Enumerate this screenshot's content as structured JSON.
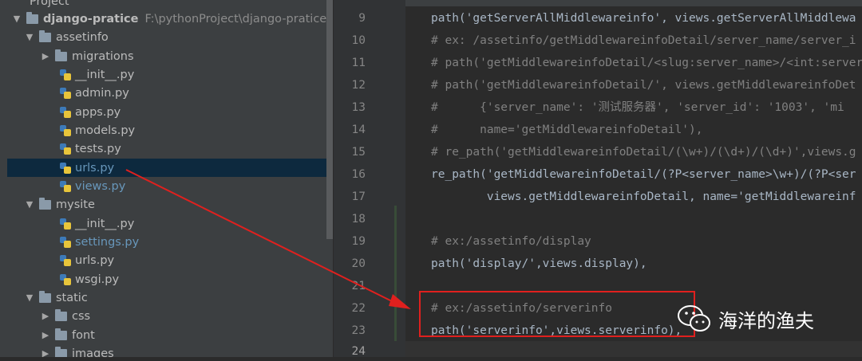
{
  "project_tree": {
    "header": "Project",
    "rows": [
      {
        "label": "django-pratice",
        "path": "F:\\pythonProject\\django-pratice",
        "type": "root"
      },
      {
        "label": "assetinfo",
        "type": "folder"
      },
      {
        "label": "migrations",
        "type": "folder"
      },
      {
        "label": "__init__.py",
        "type": "file"
      },
      {
        "label": "admin.py",
        "type": "file"
      },
      {
        "label": "apps.py",
        "type": "file"
      },
      {
        "label": "models.py",
        "type": "file"
      },
      {
        "label": "tests.py",
        "type": "file"
      },
      {
        "label": "urls.py",
        "type": "file",
        "selected": true
      },
      {
        "label": "views.py",
        "type": "file"
      },
      {
        "label": "mysite",
        "type": "folder"
      },
      {
        "label": "__init__.py",
        "type": "file"
      },
      {
        "label": "settings.py",
        "type": "file"
      },
      {
        "label": "urls.py",
        "type": "file"
      },
      {
        "label": "wsgi.py",
        "type": "file"
      },
      {
        "label": "static",
        "type": "folder"
      },
      {
        "label": "css",
        "type": "folder"
      },
      {
        "label": "font",
        "type": "folder"
      },
      {
        "label": "images",
        "type": "folder"
      }
    ]
  },
  "editor": {
    "line_numbers": [
      "9",
      "10",
      "11",
      "12",
      "13",
      "14",
      "15",
      "16",
      "17",
      "18",
      "19",
      "20",
      "21",
      "22",
      "23",
      "24"
    ],
    "lines": [
      "path('getServerAllMiddlewareinfo', views.getServerAllMiddlewa",
      "# ex: /assetinfo/getMiddlewareinfoDetail/server_name/server_i",
      "# path('getMiddlewareinfoDetail/<slug:server_name>/<int:server",
      "# path('getMiddlewareinfoDetail/', views.getMiddlewareinfoDet",
      "#      {'server_name': '测试服务器', 'server_id': '1003', 'mi",
      "#      name='getMiddlewareinfoDetail'),",
      "# re_path('getMiddlewareinfoDetail/(\\w+)/(\\d+)/(\\d+)',views.g",
      "re_path('getMiddlewareinfoDetail/(?P<server_name>\\w+)/(?P<ser",
      "        views.getMiddlewareinfoDetail, name='getMiddlewareinf",
      "",
      "# ex:/assetinfo/display",
      "path('display/',views.display),",
      "",
      "# ex:/assetinfo/serverinfo",
      "path('serverinfo',views.serverinfo),",
      ""
    ]
  },
  "watermark": {
    "text": "海洋的渔夫"
  },
  "colors": {
    "highlight_box": "#e0201e",
    "selection": "#0d293e"
  }
}
